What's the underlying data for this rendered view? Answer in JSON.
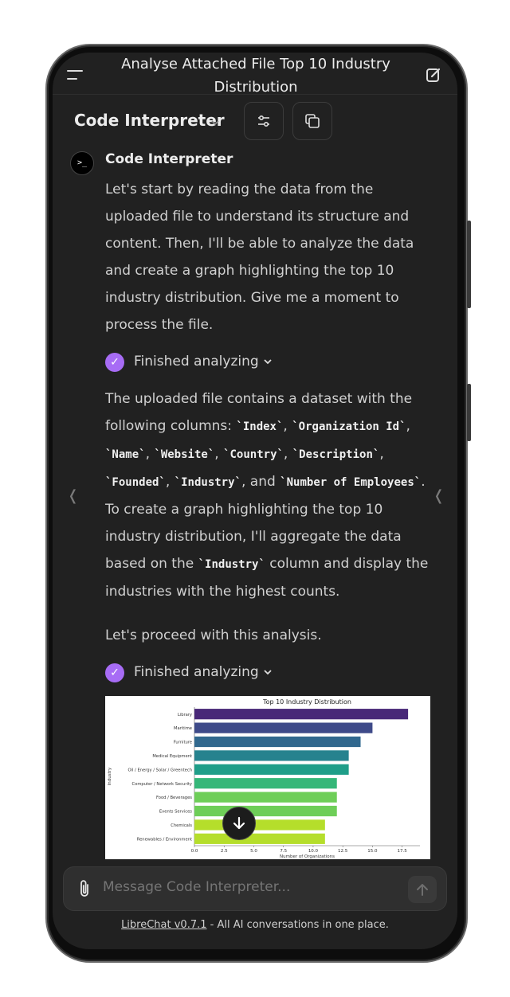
{
  "header": {
    "title": "Analyse Attached File Top 10 Industry Distribution",
    "model_name": "Code Interpreter"
  },
  "message": {
    "avatar_text": ">_",
    "sender": "Code Interpreter",
    "intro": "Let's start by reading the data from the uploaded file to understand its structure and content. Then, I'll be able to analyze the data and create a graph highlighting the top 10 industry distribution. Give me a moment to process the file.",
    "status1": "Finished analyzing",
    "p2": {
      "t1": "The uploaded file contains a dataset with the following columns: ",
      "c1": "`Index`",
      "s1": ", ",
      "c2": "`Organization Id`",
      "s2": ", ",
      "c3": "`Name`",
      "s3": ", ",
      "c4": "`Website`",
      "s4": ", ",
      "c5": "`Country`",
      "s5": ", ",
      "c6": "`Description`",
      "s6": ", ",
      "c7": "`Founded`",
      "s7": ", ",
      "c8": "`Industry`",
      "s8": ", and ",
      "c9": "`Number of Employees`",
      "t2": ". To create a graph highlighting the top 10 industry distribution, I'll aggregate the data based on the ",
      "c10": "`Industry`",
      "t3": " column and display the industries with the highest counts."
    },
    "p3": "Let's proceed with this analysis.",
    "status2": "Finished analyzing"
  },
  "chart_data": {
    "type": "bar",
    "title": "Top 10 Industry Distribution",
    "xlabel": "Number of Organizations",
    "ylabel": "Industry",
    "categories": [
      "Library",
      "Maritime",
      "Furniture",
      "Medical Equipment",
      "Oil / Energy / Solar / Greentech",
      "Computer / Network Security",
      "Food / Beverages",
      "Events Services",
      "Chemicals",
      "Renewables / Environment"
    ],
    "values": [
      18,
      15,
      14,
      13,
      13,
      12,
      12,
      12,
      11,
      11
    ],
    "xticks": [
      "0.0",
      "2.5",
      "5.0",
      "7.5",
      "10.0",
      "12.5",
      "15.0",
      "17.5"
    ],
    "xlim": [
      0,
      19
    ],
    "colors": [
      "#482878",
      "#3e4a89",
      "#31688e",
      "#26828e",
      "#1f9e89",
      "#35b779",
      "#6ece58",
      "#6ece58",
      "#b5de2b",
      "#b5de2b"
    ]
  },
  "composer": {
    "placeholder": "Message Code Interpreter..."
  },
  "footer": {
    "link": "LibreChat v0.7.1",
    "text": " - All AI conversations in one place."
  },
  "side_cues": {
    "left": "❬",
    "right": "❬"
  }
}
